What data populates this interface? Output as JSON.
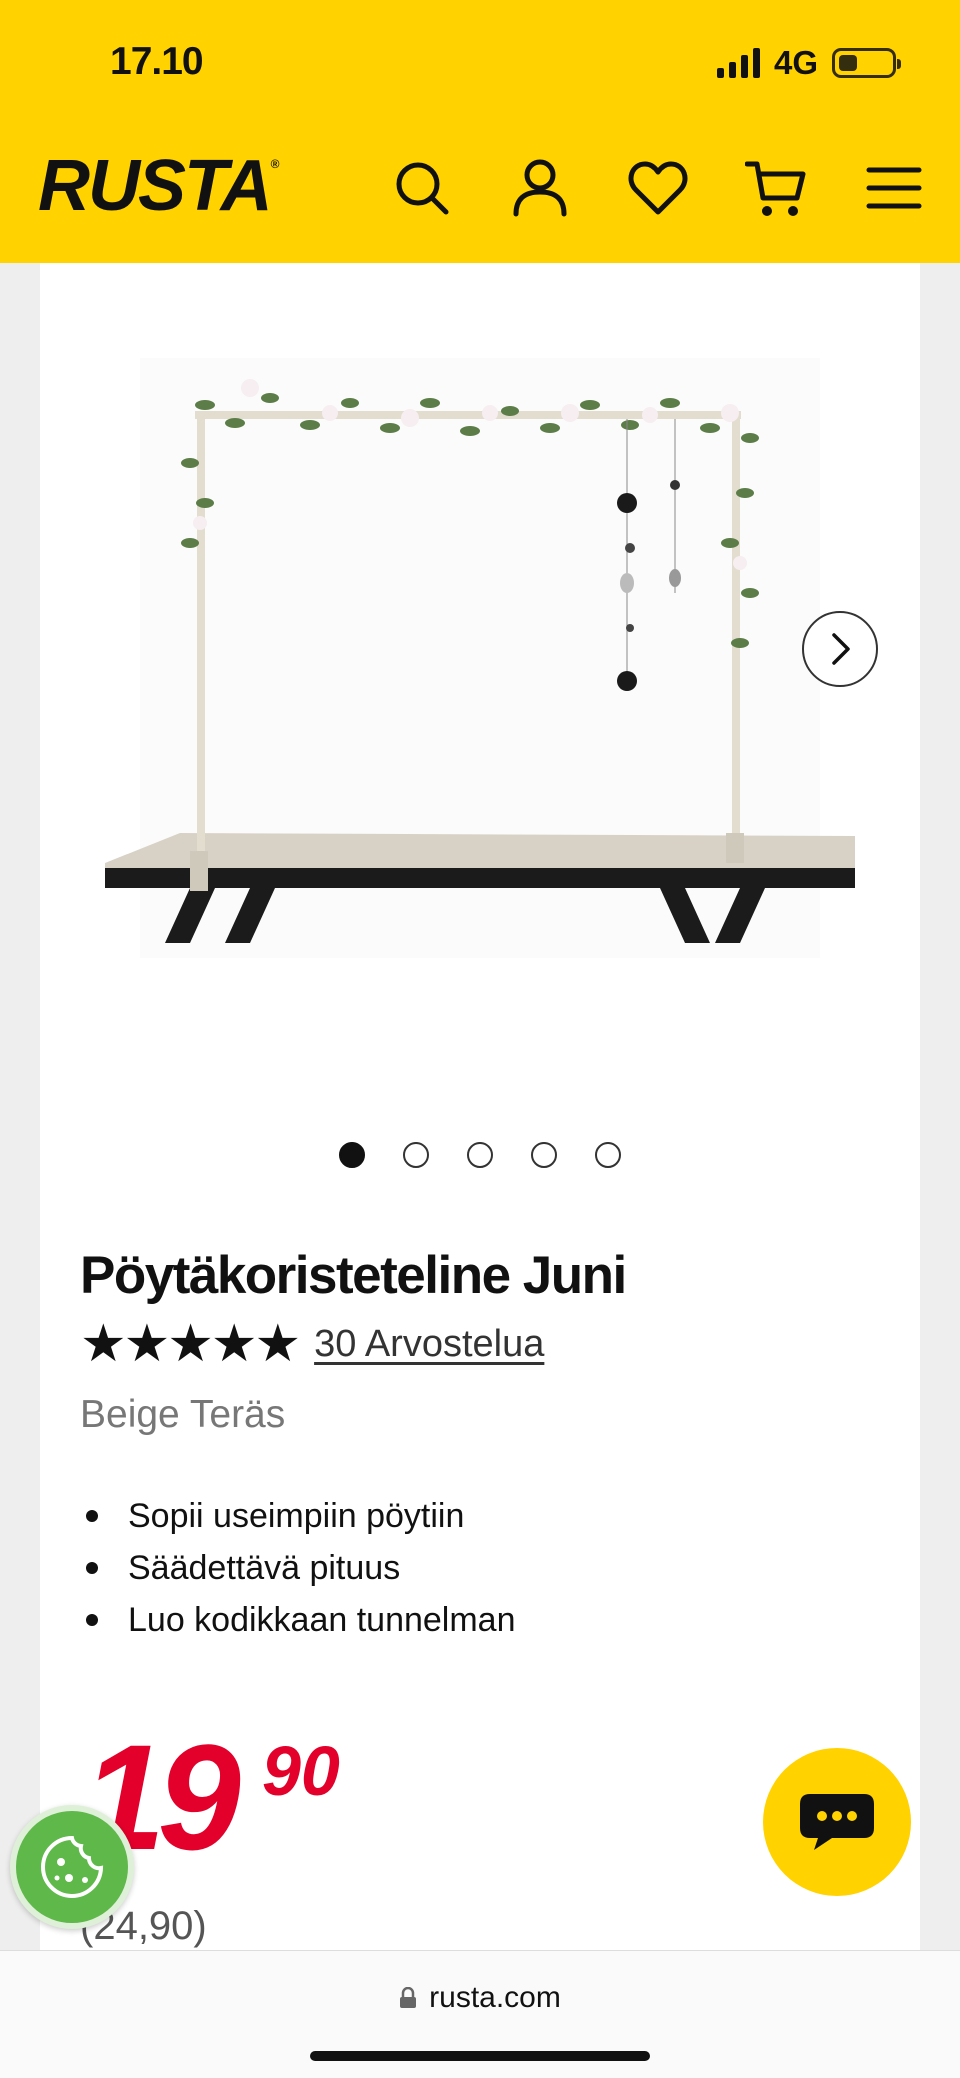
{
  "status_bar": {
    "time": "17.10",
    "network": "4G",
    "battery_level": 0.35
  },
  "header": {
    "logo": "RUSTA",
    "icons": [
      "search-icon",
      "account-icon",
      "heart-icon",
      "cart-icon",
      "menu-icon"
    ]
  },
  "gallery": {
    "total_images": 5,
    "active_index": 0
  },
  "product": {
    "title": "Pöytäkoristeteline Juni",
    "stars": "★★★★★",
    "rating": 5,
    "reviews_label": "30 Arvostelua",
    "variant": "Beige Teräs",
    "features": [
      "Sopii useimpiin pöytiin",
      "Säädettävä pituus",
      "Luo kodikkaan tunnelman"
    ],
    "price_main": "19",
    "price_cents": "90",
    "old_price": "(24,90)"
  },
  "browser": {
    "url": "rusta.com"
  },
  "colors": {
    "brand_yellow": "#FFD200",
    "price_red": "#E3002B",
    "cookie_green": "#5fb84a"
  }
}
